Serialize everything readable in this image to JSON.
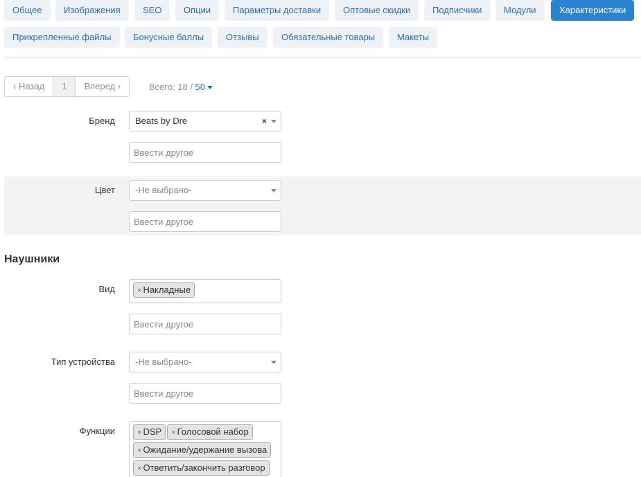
{
  "tabs": [
    {
      "label": "Общее",
      "active": false
    },
    {
      "label": "Изображения",
      "active": false
    },
    {
      "label": "SEO",
      "active": false
    },
    {
      "label": "Опции",
      "active": false
    },
    {
      "label": "Параметры доставки",
      "active": false
    },
    {
      "label": "Оптовые скидки",
      "active": false
    },
    {
      "label": "Подписчики",
      "active": false
    },
    {
      "label": "Модули",
      "active": false
    },
    {
      "label": "Характеристики",
      "active": true
    },
    {
      "label": "Прикрепленные файлы",
      "active": false
    },
    {
      "label": "Бонусные баллы",
      "active": false
    },
    {
      "label": "Отзывы",
      "active": false
    },
    {
      "label": "Обязательные товары",
      "active": false
    },
    {
      "label": "Макеты",
      "active": false
    }
  ],
  "pager": {
    "prev_label": "Назад",
    "page": "1",
    "next_label": "Вперед",
    "total_prefix": "Всего: 18 / ",
    "per_page": "50"
  },
  "colors": {
    "accent": "#2b83cf",
    "link": "#2a6fb0",
    "band": "#f3f3f3"
  },
  "fields": {
    "brand": {
      "label": "Бренд",
      "value": "Beats by Dre",
      "other_placeholder": "Ввести другое"
    },
    "color": {
      "label": "Цвет",
      "placeholder": "-Не выбрано-",
      "other_placeholder": "Ввести другое"
    }
  },
  "section": {
    "title": "Наушники"
  },
  "headphones": {
    "kind": {
      "label": "Вид",
      "chips": [
        "Накладные"
      ],
      "other_placeholder": "Ввести другое"
    },
    "device_type": {
      "label": "Тип устройства",
      "placeholder": "-Не выбрано-",
      "other_placeholder": "Ввести другое"
    },
    "functions": {
      "label": "Функции",
      "chips": [
        "DSP",
        "Голосовой набор",
        "Ожидание/удержание вызова",
        "Ответить/закончить разговор"
      ]
    }
  }
}
